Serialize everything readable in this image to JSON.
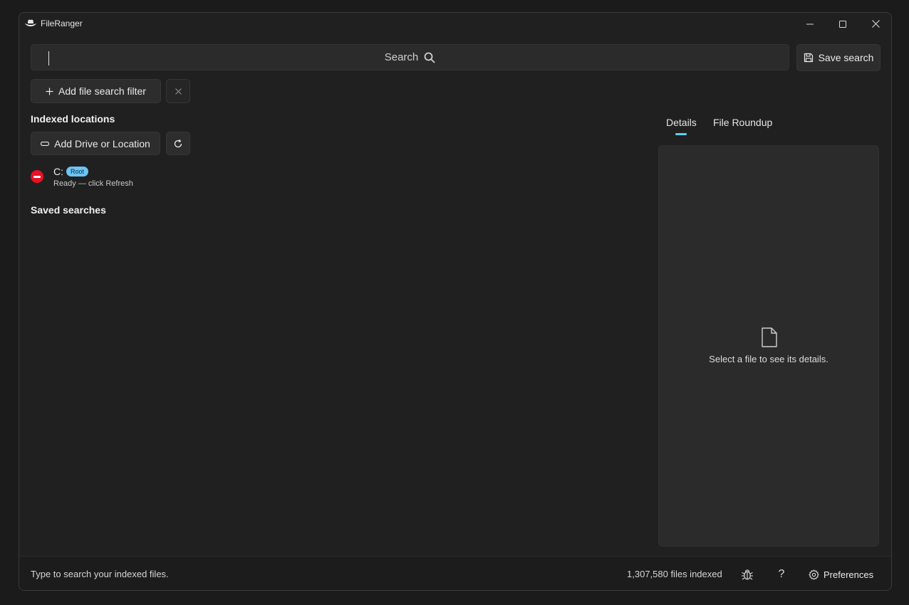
{
  "window": {
    "title": "FileRanger"
  },
  "search": {
    "placeholder": "Search",
    "save_label": "Save search"
  },
  "filters": {
    "add_label": "Add file search filter"
  },
  "indexed_locations": {
    "heading": "Indexed locations",
    "add_label": "Add Drive or Location",
    "items": [
      {
        "drive": "C:",
        "badge": "Root",
        "status": "Ready — click Refresh",
        "status_color": "#e81123"
      }
    ]
  },
  "saved_searches": {
    "heading": "Saved searches"
  },
  "details": {
    "tabs": [
      {
        "label": "Details",
        "selected": true
      },
      {
        "label": "File Roundup",
        "selected": false
      }
    ],
    "empty_message": "Select a file to see its details."
  },
  "statusbar": {
    "hint": "Type to search your indexed files.",
    "files_indexed": "1,307,580 files indexed",
    "help_label": "?",
    "preferences_label": "Preferences"
  },
  "colors": {
    "accent": "#60cdff",
    "badge": "#6cc4f5",
    "error": "#e81123",
    "background": "#202020"
  }
}
